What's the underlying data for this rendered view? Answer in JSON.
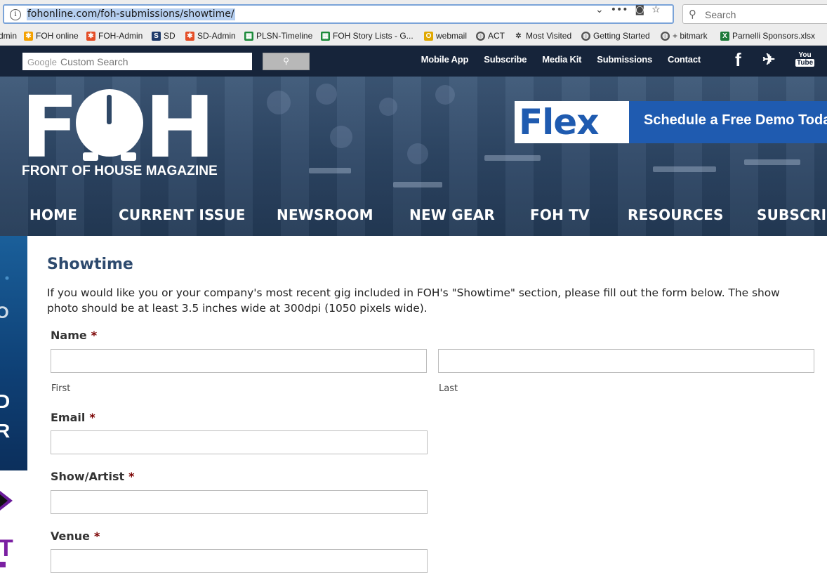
{
  "browser": {
    "url": "fohonline.com/foh-submissions/showtime/",
    "search_placeholder": "Search",
    "bookmarks": [
      {
        "label": "dmin",
        "icon": "bookmark-icon"
      },
      {
        "label": "FOH online",
        "icon": "joomla-icon"
      },
      {
        "label": "FOH-Admin",
        "icon": "joomla-icon"
      },
      {
        "label": "SD",
        "icon": "sd-icon"
      },
      {
        "label": "SD-Admin",
        "icon": "joomla-icon"
      },
      {
        "label": "PLSN-Timeline",
        "icon": "sheets-icon"
      },
      {
        "label": "FOH Story Lists - G...",
        "icon": "sheets-icon"
      },
      {
        "label": "webmail",
        "icon": "webmail-icon"
      },
      {
        "label": "ACT",
        "icon": "globe-icon"
      },
      {
        "label": "Most Visited",
        "icon": "gear-icon"
      },
      {
        "label": "Getting Started",
        "icon": "globe-icon"
      },
      {
        "label": "+ bitmark",
        "icon": "globe-icon"
      },
      {
        "label": "Parnelli Sponsors.xlsx",
        "icon": "excel-icon"
      }
    ]
  },
  "site": {
    "search_placeholder": "Custom Search",
    "search_brand": "Google",
    "top_links": [
      "Mobile App",
      "Subscribe",
      "Media Kit",
      "Submissions",
      "Contact"
    ],
    "social_icons": [
      "facebook-icon",
      "twitter-icon",
      "youtube-icon"
    ],
    "youtube_top": "You",
    "youtube_bottom": "Tube",
    "logo_letters": {
      "first": "F",
      "last": "H"
    },
    "logo_tagline": "FRONT OF HOUSE MAGAZINE",
    "ad": {
      "brand": "Flex",
      "text": "Schedule a Free Demo Today"
    },
    "nav": [
      "HOME",
      "CURRENT ISSUE",
      "NEWSROOM",
      "NEW GEAR",
      "FOH TV",
      "RESOURCES",
      "SUBSCRIB"
    ],
    "side_ad_fragments": [
      "O",
      "D",
      "R",
      "T"
    ]
  },
  "form": {
    "title": "Showtime",
    "intro": "If you would like you or your company's most recent gig included in FOH's \"Showtime\" section, please fill out the form below. The show photo should be at least 3.5 inches wide at 300dpi (1050 pixels wide).",
    "name_label": "Name",
    "first_label": "First",
    "last_label": "Last",
    "email_label": "Email",
    "show_label": "Show/Artist",
    "venue_label": "Venue",
    "required_marker": "*",
    "brand_color": "#2d4a6e",
    "required_color": "#7a0000"
  }
}
